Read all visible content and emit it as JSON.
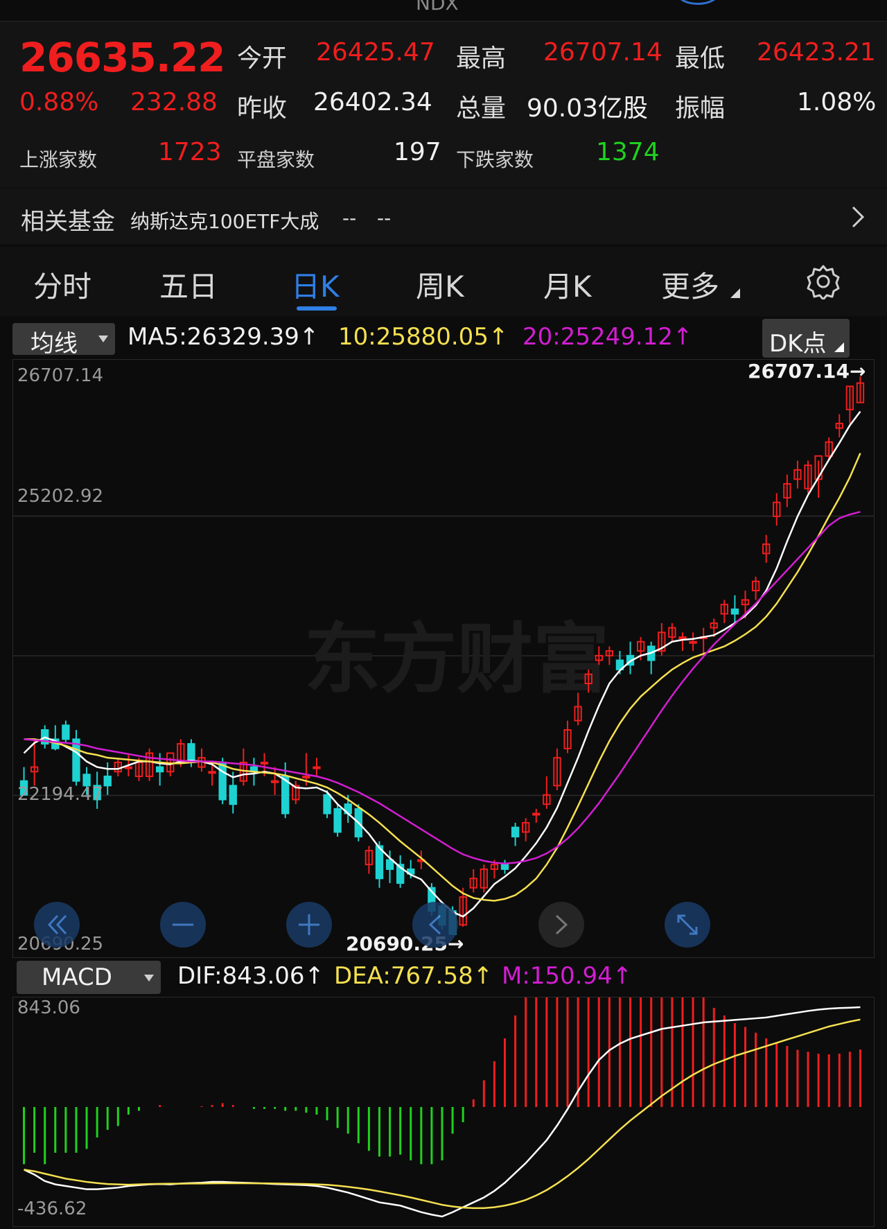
{
  "header": {
    "symbol": "NDX",
    "price": "26635.22",
    "change_pct": "0.88%",
    "change_abs": "232.88",
    "open_label": "今开",
    "open": "26425.47",
    "high_label": "最高",
    "high": "26707.14",
    "low_label": "最低",
    "low": "26423.21",
    "prev_close_label": "昨收",
    "prev_close": "26402.34",
    "volume_label": "总量",
    "volume": "90.03亿股",
    "amplitude_label": "振幅",
    "amplitude": "1.08%",
    "up_count_label": "上涨家数",
    "up_count": "1723",
    "flat_count_label": "平盘家数",
    "flat_count": "197",
    "down_count_label": "下跌家数",
    "down_count": "1374"
  },
  "fund": {
    "label": "相关基金",
    "name": "纳斯达克100ETF大成",
    "value1": "--",
    "value2": "--"
  },
  "tabs": [
    {
      "label": "分时"
    },
    {
      "label": "五日"
    },
    {
      "label": "日K"
    },
    {
      "label": "周K"
    },
    {
      "label": "月K"
    },
    {
      "label": "更多"
    }
  ],
  "active_tab": "日K",
  "ma_bar": {
    "selector": "均线",
    "ma5": "MA5:26329.39↑",
    "ma10": "10:25880.05↑",
    "ma20": "20:25249.12↑",
    "dk_button": "DK点"
  },
  "watermark": "东方财富",
  "colors": {
    "up": "#f01e1e",
    "down": "#1ed2d2",
    "ma5": "#ffffff",
    "ma10": "#f5e050",
    "ma20": "#d21ed2",
    "macd_up": "#f01e1e",
    "macd_down": "#1fd21f",
    "accent": "#2f7fe6"
  },
  "macd_bar": {
    "selector": "MACD",
    "dif": "DIF:843.06↑",
    "dea": "DEA:767.58↑",
    "m": "M:150.94↑"
  },
  "chart_data": [
    {
      "type": "candlestick",
      "title": "NDX",
      "y_axis_ticks": [
        "26707.14",
        "25202.92",
        "22194.47",
        "20690.25"
      ],
      "ylim": [
        20690.25,
        26707.14
      ],
      "max_marker": "26707.14→",
      "min_marker": "20690.25→",
      "candles": [
        [
          22350,
          22500,
          22200,
          22200
        ],
        [
          22450,
          22800,
          22500,
          22300
        ],
        [
          22900,
          22950,
          22750,
          22700
        ],
        [
          22800,
          22950,
          22700,
          22680
        ],
        [
          22950,
          23000,
          22800,
          22750
        ],
        [
          22800,
          22900,
          22350,
          22300
        ],
        [
          22420,
          22500,
          22300,
          22200
        ],
        [
          22300,
          22450,
          22150,
          22050
        ],
        [
          22400,
          22550,
          22300,
          22200
        ],
        [
          22450,
          22600,
          22550,
          22400
        ],
        [
          22500,
          22650,
          22500,
          22400
        ],
        [
          22400,
          22600,
          22550,
          22350
        ],
        [
          22400,
          22700,
          22650,
          22350
        ],
        [
          22500,
          22650,
          22450,
          22300
        ],
        [
          22450,
          22600,
          22650,
          22400
        ],
        [
          22550,
          22800,
          22750,
          22500
        ],
        [
          22750,
          22800,
          22550,
          22500
        ],
        [
          22500,
          22700,
          22600,
          22450
        ],
        [
          22450,
          22550,
          22450,
          22300
        ],
        [
          22550,
          22600,
          22150,
          22100
        ],
        [
          22300,
          22450,
          22100,
          22000
        ],
        [
          22350,
          22700,
          22550,
          22300
        ],
        [
          22500,
          22600,
          22450,
          22300
        ],
        [
          22550,
          22650,
          22550,
          22400
        ],
        [
          22350,
          22500,
          22350,
          22200
        ],
        [
          22400,
          22550,
          22000,
          21950
        ],
        [
          22150,
          22350,
          22300,
          22100
        ],
        [
          22400,
          22650,
          22400,
          22300
        ],
        [
          22500,
          22600,
          22500,
          22400
        ],
        [
          22200,
          22250,
          22000,
          21950
        ],
        [
          22050,
          22100,
          21800,
          21750
        ],
        [
          22100,
          22200,
          22000,
          21900
        ],
        [
          22050,
          22100,
          21750,
          21700
        ],
        [
          21450,
          21650,
          21600,
          21350
        ],
        [
          21650,
          21700,
          21300,
          21200
        ],
        [
          21500,
          21600,
          21400,
          21250
        ],
        [
          21450,
          21550,
          21250,
          21200
        ],
        [
          21400,
          21500,
          21350,
          21300
        ],
        [
          21500,
          21600,
          21500,
          21400
        ],
        [
          21200,
          21250,
          20950,
          20900
        ],
        [
          21000,
          21050,
          20800,
          20750
        ],
        [
          20950,
          21000,
          20700,
          20690
        ],
        [
          20800,
          21200,
          21100,
          20780
        ],
        [
          21200,
          21400,
          21300,
          21150
        ],
        [
          21200,
          21450,
          21400,
          21150
        ],
        [
          21400,
          21500,
          21450,
          21300
        ],
        [
          21450,
          21500,
          21400,
          21350
        ],
        [
          21850,
          21900,
          21750,
          21650
        ],
        [
          21800,
          21950,
          21900,
          21700
        ],
        [
          22000,
          22050,
          22000,
          21900
        ],
        [
          22100,
          22400,
          22200,
          22050
        ],
        [
          22300,
          22700,
          22600,
          22250
        ],
        [
          22700,
          23000,
          22900,
          22650
        ],
        [
          23000,
          23300,
          23150,
          22950
        ],
        [
          23400,
          23550,
          23500,
          23300
        ],
        [
          23650,
          23800,
          23700,
          23600
        ],
        [
          23700,
          23800,
          23750,
          23600
        ],
        [
          23650,
          23750,
          23550,
          23500
        ],
        [
          23700,
          23850,
          23600,
          23500
        ],
        [
          23750,
          23900,
          23850,
          23650
        ],
        [
          23800,
          23850,
          23650,
          23500
        ],
        [
          23750,
          24050,
          23950,
          23700
        ],
        [
          23900,
          24050,
          24000,
          23850
        ],
        [
          23900,
          23950,
          23900,
          23750
        ],
        [
          23850,
          23950,
          23850,
          23750
        ],
        [
          23900,
          24000,
          23900,
          23700
        ],
        [
          24000,
          24100,
          24050,
          23900
        ],
        [
          24150,
          24300,
          24250,
          24050
        ],
        [
          24200,
          24350,
          24150,
          24050
        ],
        [
          24250,
          24400,
          24300,
          24100
        ],
        [
          24400,
          24550,
          24500,
          24300
        ],
        [
          24800,
          25000,
          24900,
          24700
        ],
        [
          25200,
          25450,
          25350,
          25100
        ],
        [
          25400,
          25650,
          25550,
          25300
        ],
        [
          25600,
          25800,
          25700,
          25500
        ],
        [
          25500,
          25800,
          25750,
          25450
        ],
        [
          25600,
          25800,
          25850,
          25400
        ],
        [
          25850,
          26050,
          26000,
          25800
        ],
        [
          26150,
          26300,
          26200,
          26050
        ],
        [
          26350,
          26600,
          26600,
          26200
        ],
        [
          26425.47,
          26707.14,
          26635.22,
          26423.21
        ]
      ],
      "series": [
        {
          "name": "MA5",
          "values": [
            22650,
            22760,
            22820,
            22780,
            22720,
            22660,
            22560,
            22500,
            22480,
            22480,
            22520,
            22560,
            22560,
            22540,
            22530,
            22560,
            22570,
            22560,
            22530,
            22450,
            22390,
            22420,
            22430,
            22450,
            22430,
            22360,
            22280,
            22270,
            22280,
            22230,
            22100,
            22000,
            21900,
            21780,
            21630,
            21520,
            21420,
            21340,
            21290,
            21160,
            21040,
            20940,
            20890,
            20980,
            21110,
            21240,
            21320,
            21410,
            21540,
            21680,
            21850,
            22060,
            22330,
            22600,
            22890,
            23160,
            23400,
            23540,
            23640,
            23700,
            23730,
            23780,
            23850,
            23870,
            23880,
            23900,
            23920,
            23980,
            24050,
            24130,
            24240,
            24400,
            24640,
            24930,
            25200,
            25430,
            25620,
            25810,
            25990,
            26180,
            26329.39
          ]
        },
        {
          "name": "10",
          "values": [
            22800,
            22800,
            22780,
            22760,
            22730,
            22690,
            22650,
            22630,
            22600,
            22590,
            22580,
            22570,
            22560,
            22550,
            22540,
            22540,
            22550,
            22560,
            22550,
            22520,
            22480,
            22460,
            22450,
            22440,
            22430,
            22410,
            22380,
            22350,
            22320,
            22280,
            22220,
            22150,
            22070,
            21990,
            21900,
            21800,
            21700,
            21610,
            21520,
            21420,
            21320,
            21220,
            21140,
            21090,
            21070,
            21060,
            21080,
            21120,
            21200,
            21300,
            21450,
            21630,
            21850,
            22080,
            22320,
            22560,
            22780,
            22970,
            23130,
            23260,
            23360,
            23460,
            23550,
            23620,
            23680,
            23720,
            23760,
            23800,
            23860,
            23930,
            24010,
            24120,
            24260,
            24430,
            24600,
            24790,
            24990,
            25200,
            25400,
            25620,
            25880.05
          ]
        },
        {
          "name": "20",
          "values": [
            22800,
            22790,
            22780,
            22770,
            22760,
            22750,
            22730,
            22700,
            22680,
            22660,
            22640,
            22620,
            22600,
            22590,
            22580,
            22570,
            22560,
            22560,
            22560,
            22550,
            22540,
            22530,
            22520,
            22500,
            22480,
            22460,
            22440,
            22420,
            22400,
            22370,
            22330,
            22280,
            22230,
            22170,
            22110,
            22040,
            21970,
            21900,
            21830,
            21760,
            21690,
            21620,
            21560,
            21520,
            21490,
            21470,
            21460,
            21470,
            21490,
            21520,
            21570,
            21640,
            21730,
            21840,
            21970,
            22110,
            22270,
            22430,
            22600,
            22770,
            22940,
            23110,
            23270,
            23420,
            23560,
            23690,
            23820,
            23930,
            24040,
            24150,
            24260,
            24380,
            24500,
            24620,
            24740,
            24860,
            24980,
            25100,
            25180,
            25220,
            25249.12
          ]
        }
      ]
    },
    {
      "type": "bar",
      "title": "MACD",
      "y_axis_ticks": [
        "843.06",
        "-436.62"
      ],
      "ylim": [
        -436.62,
        843.06
      ],
      "series": [
        {
          "name": "DIF",
          "values": [
            -150,
            -180,
            -220,
            -240,
            -250,
            -260,
            -270,
            -270,
            -265,
            -260,
            -250,
            -245,
            -240,
            -238,
            -240,
            -235,
            -232,
            -230,
            -225,
            -225,
            -228,
            -230,
            -232,
            -235,
            -238,
            -240,
            -242,
            -245,
            -250,
            -260,
            -275,
            -290,
            -310,
            -330,
            -350,
            -360,
            -370,
            -390,
            -410,
            -425,
            -436.62,
            -410,
            -380,
            -350,
            -320,
            -280,
            -230,
            -170,
            -110,
            -40,
            30,
            120,
            220,
            330,
            430,
            520,
            580,
            620,
            650,
            670,
            690,
            710,
            720,
            730,
            740,
            750,
            755,
            760,
            765,
            770,
            775,
            780,
            790,
            800,
            810,
            820,
            828,
            834,
            838,
            840,
            843.06
          ]
        },
        {
          "name": "DEA",
          "values": [
            -150,
            -160,
            -175,
            -190,
            -205,
            -215,
            -225,
            -232,
            -238,
            -240,
            -242,
            -240,
            -238,
            -237,
            -236,
            -236,
            -235,
            -235,
            -234,
            -233,
            -233,
            -233,
            -234,
            -234,
            -235,
            -236,
            -237,
            -238,
            -240,
            -243,
            -248,
            -255,
            -263,
            -272,
            -283,
            -295,
            -307,
            -320,
            -335,
            -350,
            -365,
            -375,
            -382,
            -385,
            -385,
            -380,
            -370,
            -355,
            -335,
            -308,
            -275,
            -235,
            -190,
            -140,
            -85,
            -25,
            35,
            95,
            150,
            200,
            250,
            300,
            345,
            390,
            430,
            465,
            495,
            520,
            545,
            565,
            585,
            605,
            625,
            645,
            665,
            685,
            705,
            725,
            740,
            755,
            767.58
          ]
        },
        {
          "name": "M",
          "values": [
            -150,
            -120,
            -150,
            -120,
            -120,
            -120,
            -110,
            -80,
            -60,
            -50,
            -20,
            -10,
            0,
            5,
            0,
            0,
            0,
            2,
            5,
            10,
            5,
            0,
            -5,
            -5,
            -5,
            -10,
            -10,
            -15,
            -20,
            -35,
            -55,
            -70,
            -95,
            -115,
            -130,
            -130,
            -125,
            -140,
            -150,
            -150,
            -140,
            -70,
            -40,
            20,
            70,
            120,
            180,
            240,
            300,
            360,
            430,
            500,
            570,
            630,
            640,
            640,
            600,
            560,
            520,
            480,
            450,
            420,
            390,
            350,
            320,
            290,
            260,
            240,
            220,
            210,
            195,
            180,
            170,
            160,
            150,
            145,
            140,
            138,
            140,
            145,
            150.94
          ]
        }
      ]
    }
  ]
}
